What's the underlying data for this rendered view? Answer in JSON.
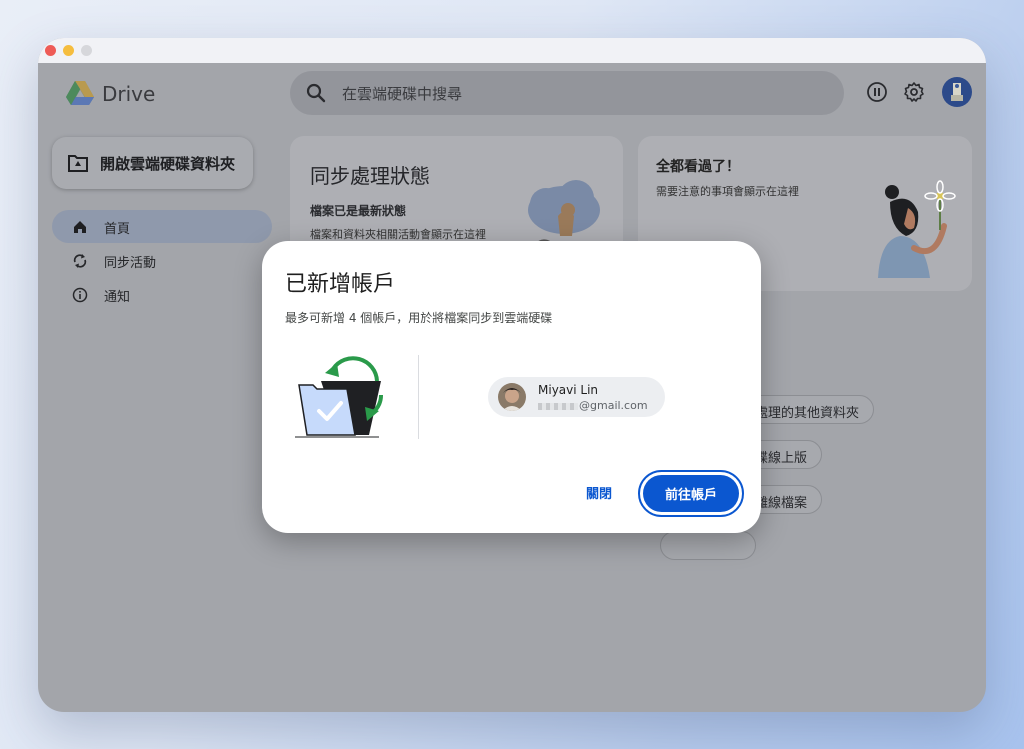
{
  "app": {
    "brand": "Drive"
  },
  "search": {
    "placeholder": "在雲端硬碟中搜尋"
  },
  "sidebar": {
    "open_folder_label": "開啟雲端硬碟資料夾",
    "items": [
      {
        "label": "首頁",
        "icon": "home-icon",
        "active": true
      },
      {
        "label": "同步活動",
        "icon": "sync-icon",
        "active": false
      },
      {
        "label": "通知",
        "icon": "info-icon",
        "active": false
      }
    ]
  },
  "cards": {
    "sync": {
      "title": "同步處理狀態",
      "subtitle": "檔案已是最新狀態",
      "description": "檔案和資料夾相關活動會顯示在這裡"
    },
    "notice": {
      "title": "全都看過了！",
      "description": "需要注意的事項會顯示在這裡"
    }
  },
  "chips": [
    "處理的其他資料夾",
    "碟線上版",
    "離線檔案"
  ],
  "dialog": {
    "title": "已新增帳戶",
    "description": "最多可新增 4 個帳戶，用於將檔案同步到雲端硬碟",
    "account": {
      "name": "Miyavi Lin",
      "email": "@gmail.com"
    },
    "close_label": "關閉",
    "go_label": "前往帳戶"
  },
  "colors": {
    "primary": "#0b57d0",
    "overlay": "#a3a5aa"
  }
}
